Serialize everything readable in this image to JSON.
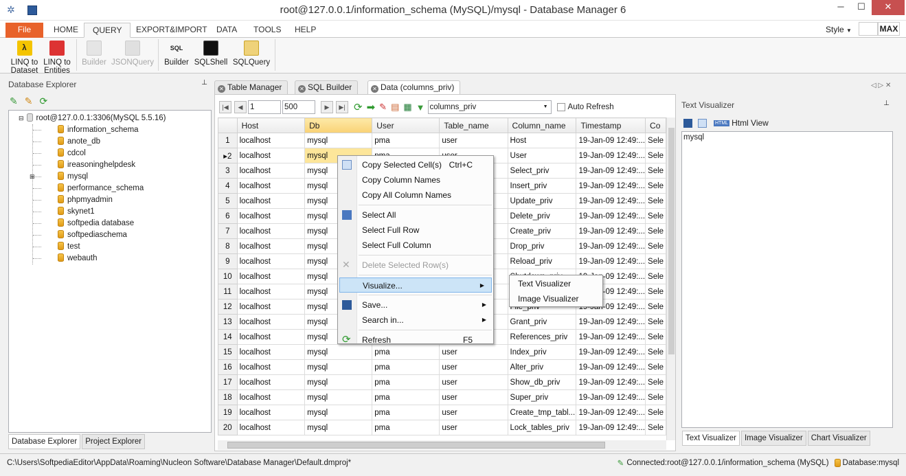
{
  "window": {
    "title": "root@127.0.0.1/information_schema (MySQL)/mysql - Database Manager 6",
    "minimize": "─",
    "maximize": "☐",
    "close": "✕"
  },
  "ribbon_tabs": [
    "File",
    "HOME",
    "QUERY",
    "EXPORT&IMPORT",
    "DATA",
    "TOOLS",
    "HELP"
  ],
  "style_label": "Style",
  "max_label": "MAX",
  "ribbon_buttons": [
    {
      "line1": "LINQ to",
      "line2": "Dataset",
      "color": "#d22"
    },
    {
      "line1": "LINQ to",
      "line2": "Entities",
      "color": "#d22"
    },
    {
      "line1": "Builder",
      "line2": "",
      "color": "#bbb"
    },
    {
      "line1": "JSONQuery",
      "line2": "",
      "color": "#bbb"
    },
    {
      "line1": "Builder",
      "line2": "",
      "color": "#333"
    },
    {
      "line1": "SQLShell",
      "line2": "",
      "color": "#111"
    },
    {
      "line1": "SQLQuery",
      "line2": "",
      "color": "#c9a227"
    }
  ],
  "left_panel": {
    "title": "Database Explorer",
    "pin": "📌",
    "root": "root@127.0.0.1:3306(MySQL 5.5.16)",
    "databases": [
      "information_schema",
      "anote_db",
      "cdcol",
      "ireasoninghelpdesk",
      "mysql",
      "performance_schema",
      "phpmyadmin",
      "skynet1",
      "softpedia database",
      "softpediaschema",
      "test",
      "webauth"
    ],
    "bottom_tabs": [
      "Database Explorer",
      "Project Explorer"
    ]
  },
  "doc_tabs": [
    "Table Manager",
    "SQL Builder",
    "Data (columns_priv)"
  ],
  "grid_toolbar": {
    "start": "1",
    "count": "500",
    "table": "columns_priv",
    "auto_refresh": "Auto Refresh"
  },
  "grid": {
    "columns": [
      "Host",
      "Db",
      "User",
      "Table_name",
      "Column_name",
      "Timestamp",
      "Co"
    ],
    "rows": [
      [
        "1",
        "localhost",
        "mysql",
        "pma",
        "user",
        "Host",
        "19-Jan-09 12:49:...",
        "Sele"
      ],
      [
        "2",
        "localhost",
        "mysql",
        "pma",
        "user",
        "User",
        "19-Jan-09 12:49:...",
        "Sele"
      ],
      [
        "3",
        "localhost",
        "mysql",
        "pma",
        "user",
        "Select_priv",
        "19-Jan-09 12:49:...",
        "Sele"
      ],
      [
        "4",
        "localhost",
        "mysql",
        "pma",
        "user",
        "Insert_priv",
        "19-Jan-09 12:49:...",
        "Sele"
      ],
      [
        "5",
        "localhost",
        "mysql",
        "pma",
        "user",
        "Update_priv",
        "19-Jan-09 12:49:...",
        "Sele"
      ],
      [
        "6",
        "localhost",
        "mysql",
        "pma",
        "user",
        "Delete_priv",
        "19-Jan-09 12:49:...",
        "Sele"
      ],
      [
        "7",
        "localhost",
        "mysql",
        "pma",
        "user",
        "Create_priv",
        "19-Jan-09 12:49:...",
        "Sele"
      ],
      [
        "8",
        "localhost",
        "mysql",
        "pma",
        "user",
        "Drop_priv",
        "19-Jan-09 12:49:...",
        "Sele"
      ],
      [
        "9",
        "localhost",
        "mysql",
        "pma",
        "user",
        "Reload_priv",
        "19-Jan-09 12:49:...",
        "Sele"
      ],
      [
        "10",
        "localhost",
        "mysql",
        "pma",
        "user",
        "Shutdown_priv",
        "19-Jan-09 12:49:...",
        "Sele"
      ],
      [
        "11",
        "localhost",
        "mysql",
        "pma",
        "user",
        "Process_priv",
        "19-Jan-09 12:49:...",
        "Sele"
      ],
      [
        "12",
        "localhost",
        "mysql",
        "pma",
        "user",
        "File_priv",
        "19-Jan-09 12:49:...",
        "Sele"
      ],
      [
        "13",
        "localhost",
        "mysql",
        "pma",
        "user",
        "Grant_priv",
        "19-Jan-09 12:49:...",
        "Sele"
      ],
      [
        "14",
        "localhost",
        "mysql",
        "pma",
        "user",
        "References_priv",
        "19-Jan-09 12:49:...",
        "Sele"
      ],
      [
        "15",
        "localhost",
        "mysql",
        "pma",
        "user",
        "Index_priv",
        "19-Jan-09 12:49:...",
        "Sele"
      ],
      [
        "16",
        "localhost",
        "mysql",
        "pma",
        "user",
        "Alter_priv",
        "19-Jan-09 12:49:...",
        "Sele"
      ],
      [
        "17",
        "localhost",
        "mysql",
        "pma",
        "user",
        "Show_db_priv",
        "19-Jan-09 12:49:...",
        "Sele"
      ],
      [
        "18",
        "localhost",
        "mysql",
        "pma",
        "user",
        "Super_priv",
        "19-Jan-09 12:49:...",
        "Sele"
      ],
      [
        "19",
        "localhost",
        "mysql",
        "pma",
        "user",
        "Create_tmp_tabl...",
        "19-Jan-09 12:49:...",
        "Sele"
      ],
      [
        "20",
        "localhost",
        "mysql",
        "pma",
        "user",
        "Lock_tables_priv",
        "19-Jan-09 12:49:...",
        "Sele"
      ]
    ]
  },
  "context_menu": {
    "copy_cells": "Copy Selected Cell(s)",
    "copy_cells_sc": "Ctrl+C",
    "copy_cols": "Copy Column Names",
    "copy_all_cols": "Copy All Column Names",
    "select_all": "Select All",
    "select_row": "Select Full Row",
    "select_col": "Select Full Column",
    "delete_rows": "Delete Selected Row(s)",
    "visualize": "Visualize...",
    "save": "Save...",
    "search": "Search in...",
    "refresh": "Refresh",
    "refresh_sc": "F5"
  },
  "submenu": {
    "text": "Text Visualizer",
    "image": "Image Visualizer"
  },
  "right_panel": {
    "title": "Text Visualizer",
    "html_view": "Html View",
    "html_badge": "HTML",
    "content": "mysql",
    "tabs": [
      "Text Visualizer",
      "Image Visualizer",
      "Chart Visualizer"
    ]
  },
  "status": {
    "path": "C:\\Users\\SoftpediaEditor\\AppData\\Roaming\\Nucleon Software\\Database Manager\\Default.dmproj*",
    "connected_label": "Connected:",
    "connected": "root@127.0.0.1/information_schema (MySQL)",
    "database_label": "Database:",
    "database": "mysql"
  }
}
